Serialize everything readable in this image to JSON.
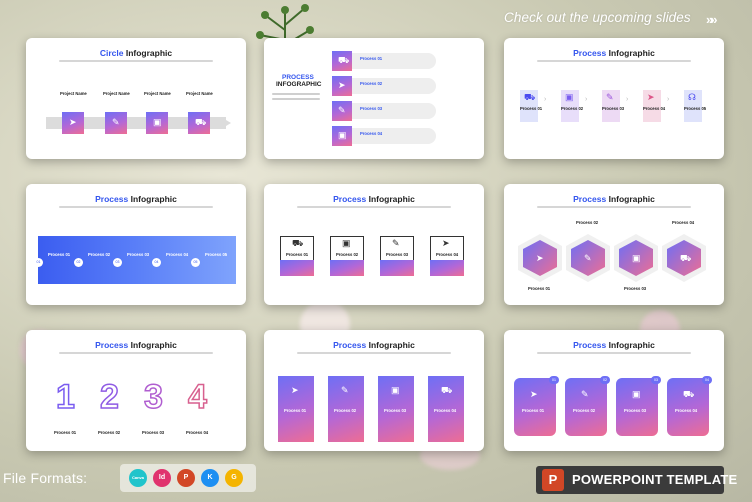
{
  "header": {
    "text": "Check out the upcoming slides",
    "chevrons": "»»"
  },
  "footer": {
    "file_formats_label": "File Formats:",
    "formats": [
      {
        "name": "canva-icon",
        "glyph": "Canva",
        "color": "#20c4cb"
      },
      {
        "name": "indesign-icon",
        "glyph": "Id",
        "color": "#e0336e"
      },
      {
        "name": "powerpoint-icon",
        "glyph": "P",
        "color": "#d24726"
      },
      {
        "name": "keynote-icon",
        "glyph": "K",
        "color": "#1d8ff2"
      },
      {
        "name": "google-slides-icon",
        "glyph": "G",
        "color": "#f4b400"
      }
    ],
    "badge_glyph": "P",
    "badge_text": "POWERPOINT TEMPLATE"
  },
  "slides": {
    "s1": {
      "title_a": "Circle",
      "title_b": "Infographic",
      "items": [
        "Project Name",
        "Project Name",
        "Project Name",
        "Project Name"
      ]
    },
    "s2": {
      "title_a": "PROCESS",
      "title_b": "INFOGRAPHIC",
      "items": [
        "Process 01",
        "Process 02",
        "Process 03",
        "Process 04"
      ]
    },
    "s3": {
      "title_a": "Process",
      "title_b": "Infographic",
      "items": [
        "Process 01",
        "Process 02",
        "Process 03",
        "Process 04",
        "Process 05"
      ]
    },
    "s4": {
      "title_a": "Process",
      "title_b": "Infographic",
      "items": [
        "Process 01",
        "Process 02",
        "Process 03",
        "Process 04",
        "Process 05"
      ],
      "nodes": [
        "01",
        "02",
        "03",
        "04",
        "05"
      ]
    },
    "s5": {
      "title_a": "Process",
      "title_b": "Infographic",
      "items": [
        "Process 01",
        "Process 02",
        "Process 03",
        "Process 04"
      ]
    },
    "s6": {
      "title_a": "Process",
      "title_b": "Infographic",
      "items": [
        "Process 01",
        "Process 02",
        "Process 03",
        "Process 04"
      ]
    },
    "s7": {
      "title_a": "Process",
      "title_b": "Infographic",
      "numbers": [
        "1",
        "2",
        "3",
        "4"
      ],
      "items": [
        "Process 01",
        "Process 02",
        "Process 03",
        "Process 04"
      ]
    },
    "s8": {
      "title_a": "Process",
      "title_b": "Infographic",
      "items": [
        "Process 01",
        "Process 02",
        "Process 03",
        "Process 04"
      ]
    },
    "s9": {
      "title_a": "Process",
      "title_b": "Infographic",
      "items": [
        "Process 01",
        "Process 02",
        "Process 03",
        "Process 04"
      ],
      "tabs": [
        "01",
        "02",
        "03",
        "04"
      ]
    }
  },
  "icons": [
    "send-icon",
    "edit-icon",
    "shopping-bag-icon",
    "cart-icon",
    "headset-icon"
  ],
  "colors": {
    "accent": "#3355ee",
    "gradient_start": "#6e6ff5",
    "gradient_end": "#ee6d93"
  }
}
